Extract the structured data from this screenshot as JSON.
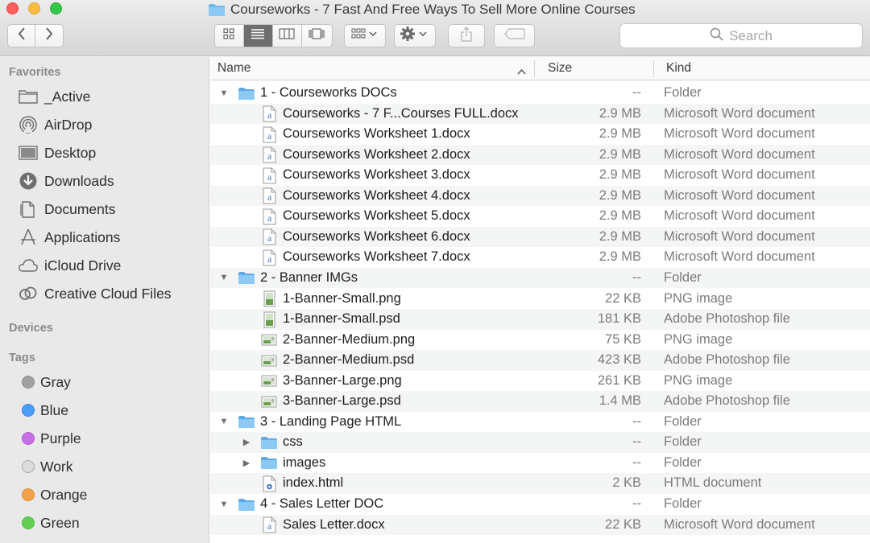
{
  "window": {
    "title": "Courseworks - 7 Fast And Free Ways To Sell More Online Courses"
  },
  "toolbar": {
    "search_placeholder": "Search",
    "view_modes": [
      "icon-view",
      "list-view",
      "column-view",
      "cover-flow-view"
    ],
    "active_view": "list-view"
  },
  "sidebar": {
    "favorites_label": "Favorites",
    "favorites": [
      {
        "label": "_Active",
        "icon": "folder-icon"
      },
      {
        "label": "AirDrop",
        "icon": "airdrop-icon"
      },
      {
        "label": "Desktop",
        "icon": "desktop-icon"
      },
      {
        "label": "Downloads",
        "icon": "downloads-icon"
      },
      {
        "label": "Documents",
        "icon": "documents-icon"
      },
      {
        "label": "Applications",
        "icon": "applications-icon"
      },
      {
        "label": "iCloud Drive",
        "icon": "cloud-icon"
      },
      {
        "label": "Creative Cloud Files",
        "icon": "creative-cloud-icon"
      }
    ],
    "devices_label": "Devices",
    "tags_label": "Tags",
    "tags": [
      {
        "label": "Gray",
        "color": "#a1a1a1"
      },
      {
        "label": "Blue",
        "color": "#4b9dfb"
      },
      {
        "label": "Purple",
        "color": "#c66fe6"
      },
      {
        "label": "Work",
        "color": "#dcdcdc"
      },
      {
        "label": "Orange",
        "color": "#f5a14a"
      },
      {
        "label": "Green",
        "color": "#63d054"
      }
    ]
  },
  "columns": {
    "name": "Name",
    "size": "Size",
    "kind": "Kind"
  },
  "files": [
    {
      "name": "1 - Courseworks DOCs",
      "size": "--",
      "kind": "Folder",
      "type": "folder",
      "level": 0,
      "disclosure": "open"
    },
    {
      "name": "Courseworks - 7 F...Courses FULL.docx",
      "size": "2.9 MB",
      "kind": "Microsoft Word document",
      "type": "doc",
      "level": 1
    },
    {
      "name": "Courseworks Worksheet 1.docx",
      "size": "2.9 MB",
      "kind": "Microsoft Word document",
      "type": "doc",
      "level": 1
    },
    {
      "name": "Courseworks Worksheet 2.docx",
      "size": "2.9 MB",
      "kind": "Microsoft Word document",
      "type": "doc",
      "level": 1
    },
    {
      "name": "Courseworks Worksheet 3.docx",
      "size": "2.9 MB",
      "kind": "Microsoft Word document",
      "type": "doc",
      "level": 1
    },
    {
      "name": "Courseworks Worksheet 4.docx",
      "size": "2.9 MB",
      "kind": "Microsoft Word document",
      "type": "doc",
      "level": 1
    },
    {
      "name": "Courseworks Worksheet 5.docx",
      "size": "2.9 MB",
      "kind": "Microsoft Word document",
      "type": "doc",
      "level": 1
    },
    {
      "name": "Courseworks Worksheet 6.docx",
      "size": "2.9 MB",
      "kind": "Microsoft Word document",
      "type": "doc",
      "level": 1
    },
    {
      "name": "Courseworks Worksheet 7.docx",
      "size": "2.9 MB",
      "kind": "Microsoft Word document",
      "type": "doc",
      "level": 1
    },
    {
      "name": "2 - Banner IMGs",
      "size": "--",
      "kind": "Folder",
      "type": "folder",
      "level": 0,
      "disclosure": "open"
    },
    {
      "name": "1-Banner-Small.png",
      "size": "22 KB",
      "kind": "PNG image",
      "type": "image-tall",
      "level": 1
    },
    {
      "name": "1-Banner-Small.psd",
      "size": "181 KB",
      "kind": "Adobe Photoshop file",
      "type": "image-tall",
      "level": 1
    },
    {
      "name": "2-Banner-Medium.png",
      "size": "75 KB",
      "kind": "PNG image",
      "type": "image-wide",
      "level": 1
    },
    {
      "name": "2-Banner-Medium.psd",
      "size": "423 KB",
      "kind": "Adobe Photoshop file",
      "type": "image-wide",
      "level": 1
    },
    {
      "name": "3-Banner-Large.png",
      "size": "261 KB",
      "kind": "PNG image",
      "type": "image-wide",
      "level": 1
    },
    {
      "name": "3-Banner-Large.psd",
      "size": "1.4 MB",
      "kind": "Adobe Photoshop file",
      "type": "image-wide",
      "level": 1
    },
    {
      "name": "3 - Landing Page HTML",
      "size": "--",
      "kind": "Folder",
      "type": "folder",
      "level": 0,
      "disclosure": "open"
    },
    {
      "name": "css",
      "size": "--",
      "kind": "Folder",
      "type": "folder",
      "level": 1,
      "disclosure": "closed"
    },
    {
      "name": "images",
      "size": "--",
      "kind": "Folder",
      "type": "folder",
      "level": 1,
      "disclosure": "closed"
    },
    {
      "name": "index.html",
      "size": "2 KB",
      "kind": "HTML document",
      "type": "html",
      "level": 1
    },
    {
      "name": "4 - Sales Letter DOC",
      "size": "--",
      "kind": "Folder",
      "type": "folder",
      "level": 0,
      "disclosure": "open"
    },
    {
      "name": "Sales Letter.docx",
      "size": "22 KB",
      "kind": "Microsoft Word document",
      "type": "doc",
      "level": 1
    }
  ]
}
